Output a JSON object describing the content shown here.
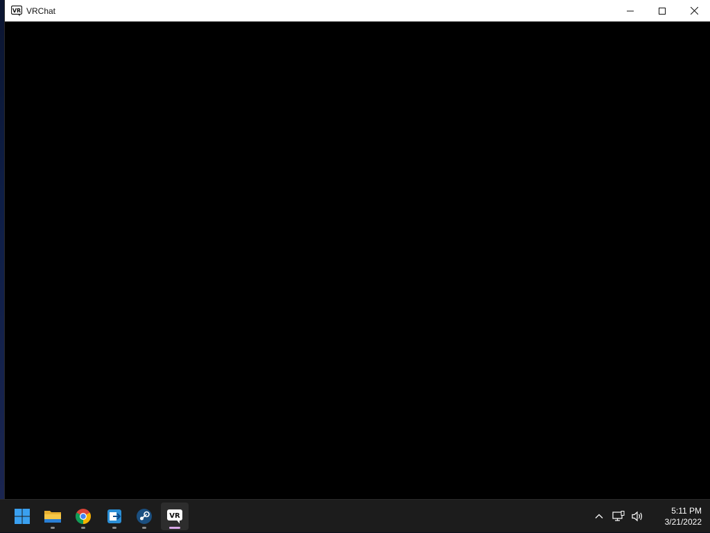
{
  "window": {
    "title": "VRChat",
    "app_icon_text": "VR"
  },
  "taskbar": {
    "apps": [
      {
        "name": "Start",
        "icon": "windows-start-icon"
      },
      {
        "name": "File Explorer",
        "icon": "folder-icon"
      },
      {
        "name": "Google Chrome",
        "icon": "chrome-icon"
      },
      {
        "name": "App",
        "icon": "app-arrow-icon"
      },
      {
        "name": "Steam",
        "icon": "steam-icon"
      },
      {
        "name": "VRChat",
        "icon": "vrchat-icon",
        "active": true,
        "label": "VR"
      }
    ],
    "clock": {
      "time": "5:11 PM",
      "date": "3/21/2022"
    }
  },
  "colors": {
    "taskbar_bg": "#1c1c1c",
    "titlebar_bg": "#ffffff",
    "content_bg": "#000000",
    "active_indicator": "#d9a8e8"
  }
}
